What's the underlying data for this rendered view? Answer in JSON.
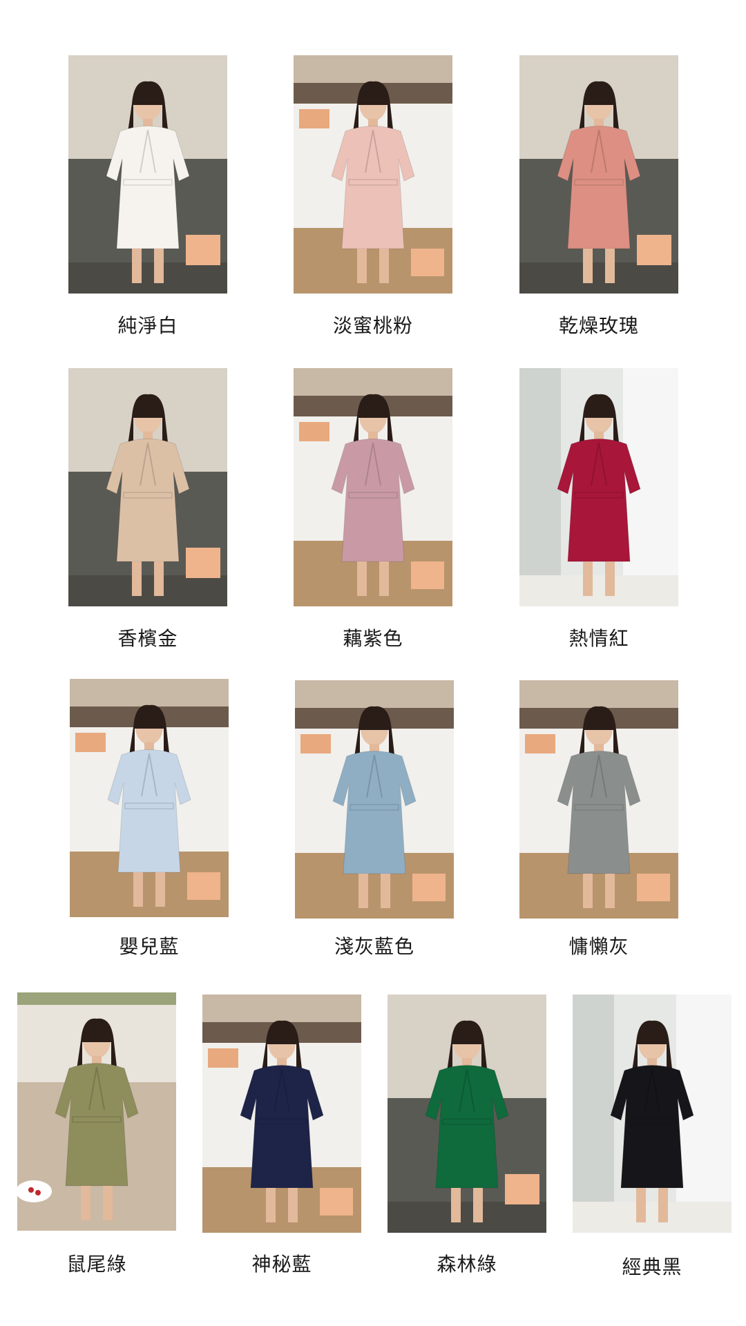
{
  "products": [
    {
      "label": "純淨白",
      "robe_color": "#f6f3ee",
      "scene": "sofa"
    },
    {
      "label": "淡蜜桃粉",
      "robe_color": "#ecc1b8",
      "scene": "bed"
    },
    {
      "label": "乾燥玫瑰",
      "robe_color": "#dc8f82",
      "scene": "sofa"
    },
    {
      "label": "香檳金",
      "robe_color": "#dcc0a6",
      "scene": "sofa"
    },
    {
      "label": "藕紫色",
      "robe_color": "#c99aa6",
      "scene": "bed"
    },
    {
      "label": "熱情紅",
      "robe_color": "#a8163a",
      "scene": "window"
    },
    {
      "label": "嬰兒藍",
      "robe_color": "#c6d6e6",
      "scene": "bed"
    },
    {
      "label": "淺灰藍色",
      "robe_color": "#8faec4",
      "scene": "bed"
    },
    {
      "label": "慵懶灰",
      "robe_color": "#8a8f8d",
      "scene": "bed"
    },
    {
      "label": "鼠尾綠",
      "robe_color": "#8e8d5c",
      "scene": "lounge"
    },
    {
      "label": "神秘藍",
      "robe_color": "#1e2448",
      "scene": "bed"
    },
    {
      "label": "森林綠",
      "robe_color": "#0f6a3c",
      "scene": "sofa"
    },
    {
      "label": "經典黑",
      "robe_color": "#16161a",
      "scene": "window"
    }
  ]
}
